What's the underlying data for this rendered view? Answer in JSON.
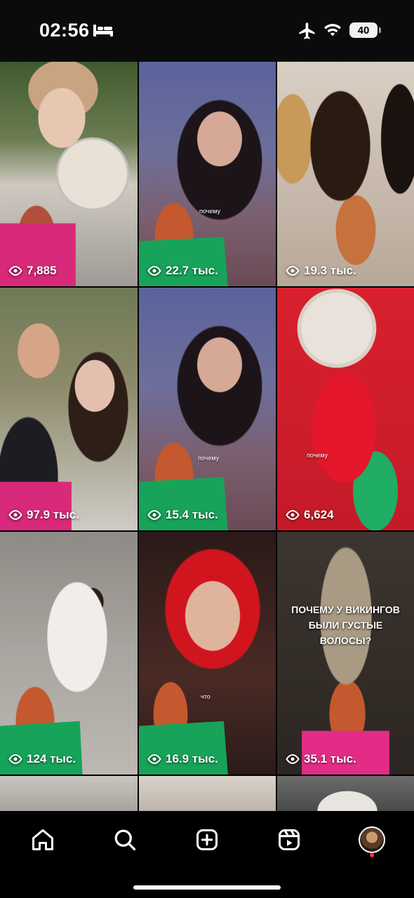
{
  "status_bar": {
    "time": "02:56",
    "battery": "40"
  },
  "grid": {
    "tiles": [
      {
        "views": "7,885",
        "caption": ""
      },
      {
        "views": "22.7 тыс.",
        "caption": "почему"
      },
      {
        "views": "19.3 тыс.",
        "caption": ""
      },
      {
        "views": "97.9 тыс.",
        "caption": ""
      },
      {
        "views": "15.4 тыс.",
        "caption": "почему"
      },
      {
        "views": "6,624",
        "caption": "почему"
      },
      {
        "views": "124 тыс.",
        "caption": ""
      },
      {
        "views": "16.9 тыс.",
        "caption": "что"
      },
      {
        "views": "35.1 тыс.",
        "caption": "",
        "title": "ПОЧЕМУ У ВИКИНГОВ БЫЛИ ГУСТЫЕ ВОЛОСЫ?"
      }
    ]
  },
  "bottom_nav": {
    "items": [
      "home",
      "search",
      "create",
      "reels",
      "profile"
    ]
  },
  "colors": {
    "background": "#000000",
    "notification": "#ff3040"
  }
}
